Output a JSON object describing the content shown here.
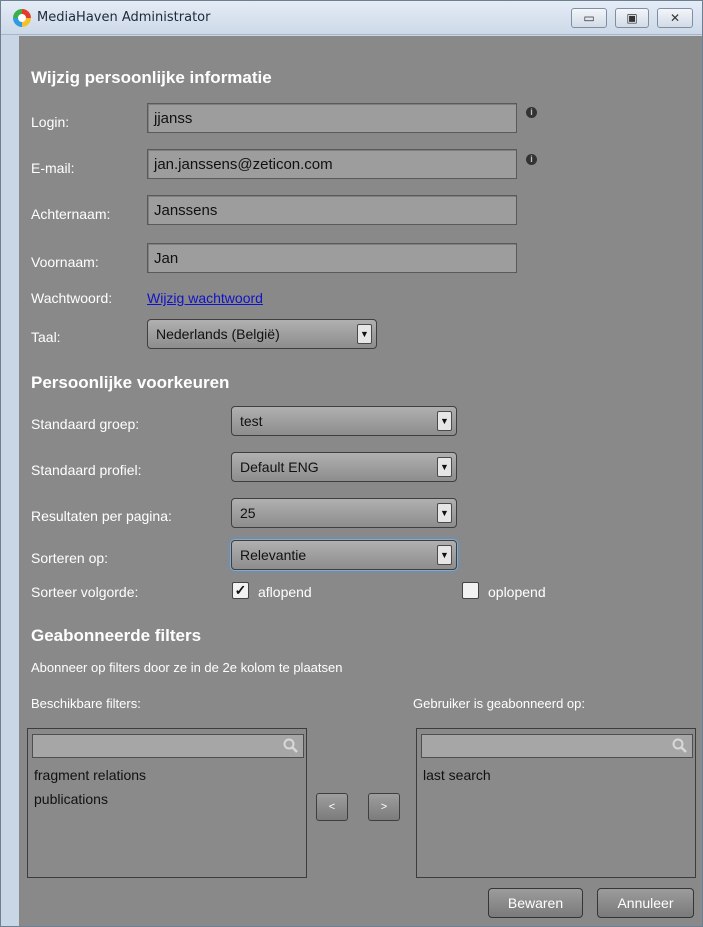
{
  "window": {
    "title": "MediaHaven Administrator",
    "controls": {
      "minimize": "▭",
      "maximize": "▣",
      "close": "✕"
    }
  },
  "personal": {
    "title": "Wijzig persoonlijke informatie",
    "login_label": "Login:",
    "login_value": "jjanss",
    "email_label": "E-mail:",
    "email_value": "jan.janssens@zeticon.com",
    "lastname_label": "Achternaam:",
    "lastname_value": "Janssens",
    "firstname_label": "Voornaam:",
    "firstname_value": "Jan",
    "password_label": "Wachtwoord:",
    "password_link": "Wijzig wachtwoord",
    "language_label": "Taal:",
    "language_value": "Nederlands (België)",
    "info_glyph": "i"
  },
  "preferences": {
    "title": "Persoonlijke voorkeuren",
    "group_label": "Standaard groep:",
    "group_value": "test",
    "profile_label": "Standaard profiel:",
    "profile_value": "Default ENG",
    "results_label": "Resultaten per pagina:",
    "results_value": "25",
    "sort_label": "Sorteren op:",
    "sort_value": "Relevantie",
    "order_label": "Sorteer volgorde:",
    "descending_label": "aflopend",
    "descending_checked": true,
    "ascending_label": "oplopend",
    "ascending_checked": false,
    "check_glyph": "✓",
    "dropdown_glyph": "▼"
  },
  "filters": {
    "title": "Geabonneerde filters",
    "instruction": "Abonneer op filters door ze in de 2e kolom te plaatsen",
    "available_label": "Beschikbare filters:",
    "subscribed_label": "Gebruiker is geabonneerd op:",
    "available_items": [
      "fragment relations",
      "publications"
    ],
    "subscribed_items": [
      "last search"
    ],
    "move_left": "<",
    "move_right": ">"
  },
  "actions": {
    "save": "Bewaren",
    "cancel": "Annuleer"
  },
  "colors": {
    "panel": "#898989",
    "link": "#1212c9",
    "focus": "#6f8fb3"
  },
  "icons": [
    "app-logo-icon",
    "info-icon",
    "search-icon",
    "dropdown-arrow-icon",
    "check-icon"
  ]
}
